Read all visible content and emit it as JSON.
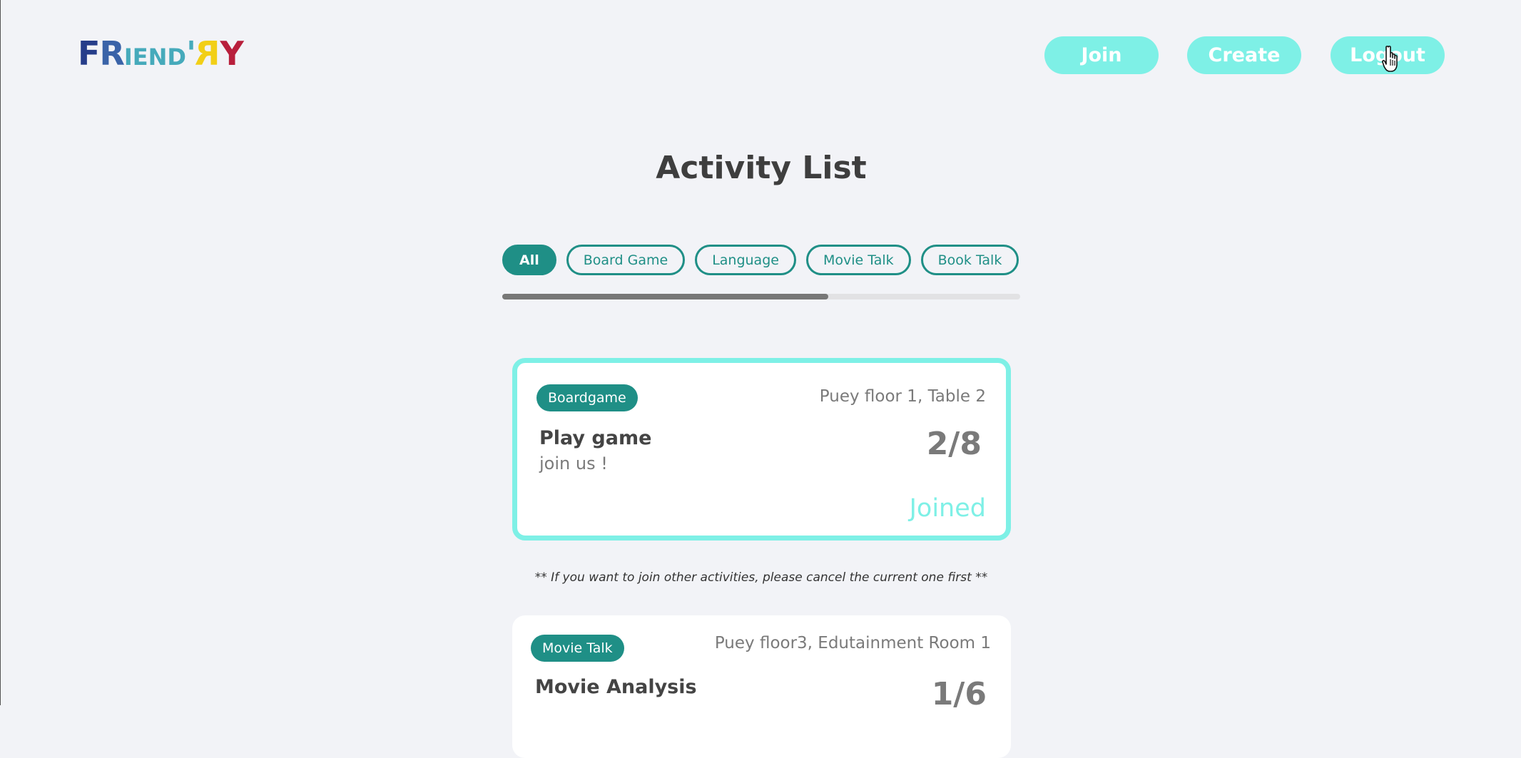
{
  "header": {
    "logo": {
      "text": "FRiend'RY",
      "parts": [
        "F",
        "R",
        "IEND",
        "'",
        "R",
        "Y"
      ],
      "colors": [
        "#263d8a",
        "#3a63a8",
        "#46aabb",
        "#46aabb",
        "#f2cf17",
        "#b81f3c"
      ]
    },
    "nav": {
      "join_label": "Join",
      "create_label": "Create",
      "logout_label": "Logout"
    },
    "cursor_icon": "hand-pointer-icon"
  },
  "main": {
    "title": "Activity List",
    "filters": [
      "All",
      "Board Game",
      "Language",
      "Movie Talk",
      "Book Talk"
    ],
    "active_filter": "All",
    "filter_scroll_fraction": 0.63,
    "activities": [
      {
        "tag": "Boardgame",
        "location": "Puey floor 1, Table 2",
        "title": "Play game",
        "description": "join us !",
        "count": "2/8",
        "status": "Joined"
      },
      {
        "tag": "Movie Talk",
        "location": "Puey floor3, Edutainment Room 1",
        "title": "Movie Analysis",
        "count": "1/6"
      }
    ],
    "note": "** If you want to join other activities, please cancel the current one first **"
  },
  "colors": {
    "accent": "#7ef0e6",
    "primary": "#1f8f86",
    "background": "#f2f3f7"
  }
}
